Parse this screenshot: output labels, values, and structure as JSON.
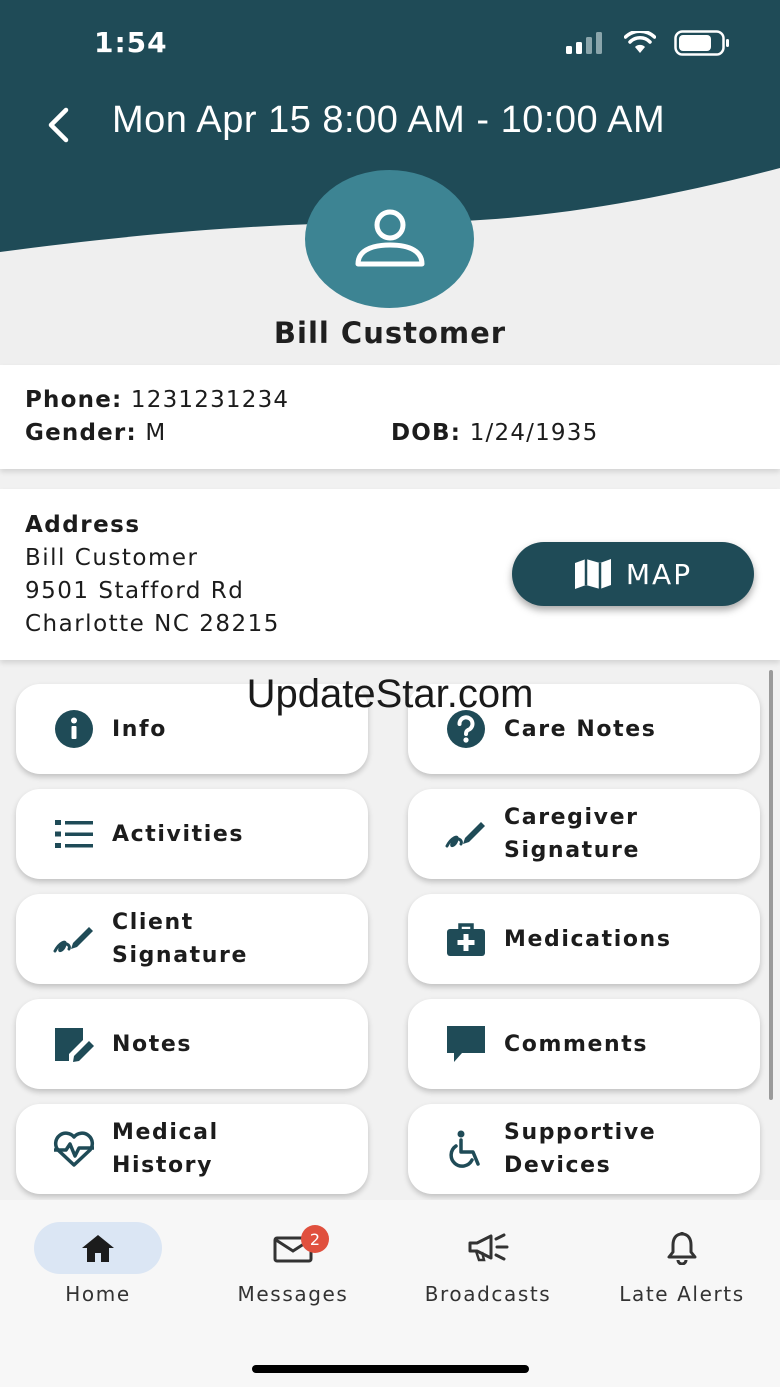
{
  "status_bar": {
    "time": "1:54"
  },
  "header": {
    "title": "Mon Apr 15 8:00 AM - 10:00 AM",
    "client_name": "Bill Customer"
  },
  "details": {
    "phone_label": "Phone:",
    "phone": "1231231234",
    "gender_label": "Gender:",
    "gender": "M",
    "dob_label": "DOB:",
    "dob": "1/24/1935"
  },
  "address": {
    "label": "Address",
    "lines": [
      "Bill Customer",
      "9501 Stafford Rd",
      "Charlotte NC 28215"
    ],
    "map_label": "MAP"
  },
  "tiles": [
    {
      "label": "Info",
      "icon": "info-icon"
    },
    {
      "label": "Care Notes",
      "icon": "question-icon"
    },
    {
      "label": "Activities",
      "icon": "list-icon"
    },
    {
      "label": "Caregiver\nSignature",
      "icon": "signature-icon"
    },
    {
      "label": "Client\nSignature",
      "icon": "signature-icon"
    },
    {
      "label": "Medications",
      "icon": "medical-bag-icon"
    },
    {
      "label": "Notes",
      "icon": "note-edit-icon"
    },
    {
      "label": "Comments",
      "icon": "comment-icon"
    },
    {
      "label": "Medical\nHistory",
      "icon": "heart-pulse-icon"
    },
    {
      "label": "Supportive\nDevices",
      "icon": "wheelchair-icon"
    }
  ],
  "watermark": "UpdateStar.com",
  "bottom_nav": [
    {
      "label": "Home",
      "icon": "home-icon",
      "active": true
    },
    {
      "label": "Messages",
      "icon": "mail-icon",
      "badge": "2"
    },
    {
      "label": "Broadcasts",
      "icon": "megaphone-icon"
    },
    {
      "label": "Late Alerts",
      "icon": "bell-icon"
    }
  ],
  "colors": {
    "primary": "#1f4b57",
    "avatar": "#3d8493",
    "badge": "#e0503e",
    "active_pill": "#dbe6f4"
  }
}
